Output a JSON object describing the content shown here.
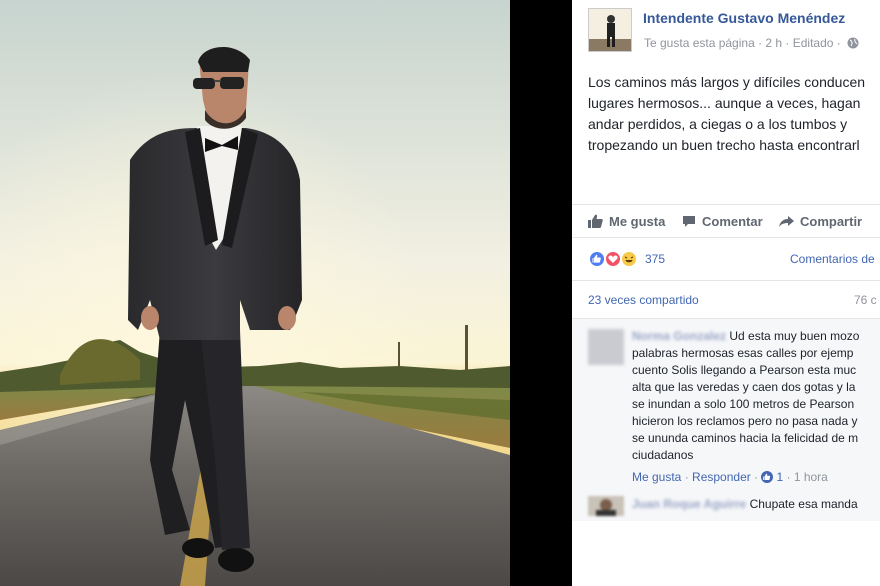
{
  "post": {
    "page_name": "Intendente Gustavo Menéndez",
    "meta": "Te gusta esta página · 2 h · Editado ·",
    "text_lines": [
      "Los caminos más largos y difíciles conducen",
      "lugares hermosos... aunque a veces, hagan",
      "andar perdidos, a ciegas o a los tumbos y",
      "tropezando un buen trecho hasta encontrarl"
    ]
  },
  "actions": {
    "like": "Me gusta",
    "comment": "Comentar",
    "share": "Compartir"
  },
  "reactions": {
    "count": "375",
    "comments_link": "Comentarios de",
    "icons": [
      "like-reaction-icon",
      "love-reaction-icon",
      "haha-reaction-icon"
    ],
    "colors": {
      "like": "#4f7df3",
      "love": "#f25268",
      "haha": "#f7c94a"
    }
  },
  "shares": {
    "text": "23 veces compartido",
    "comments_count": "76 c"
  },
  "comments": [
    {
      "author": "Norma Gonzalez",
      "text_lines": [
        " Ud esta muy buen mozo",
        "palabras hermosas esas calles por ejemp",
        "cuento Solis llegando a Pearson esta muc",
        "alta que las veredas y caen dos gotas y la",
        "se inundan a solo 100 metros de Pearson",
        "hicieron los reclamos pero no pasa nada y",
        "se ununda caminos hacia la felicidad de m",
        "ciudadanos"
      ],
      "like_label": "Me gusta",
      "reply_label": "Responder",
      "like_count": "1",
      "time": "1 hora"
    },
    {
      "author": "Juan Roque Aguirre",
      "text": " Chupate esa manda"
    }
  ],
  "theme": {
    "link_color": "#365899",
    "accent": "#4267b2",
    "muted": "#90949c"
  }
}
